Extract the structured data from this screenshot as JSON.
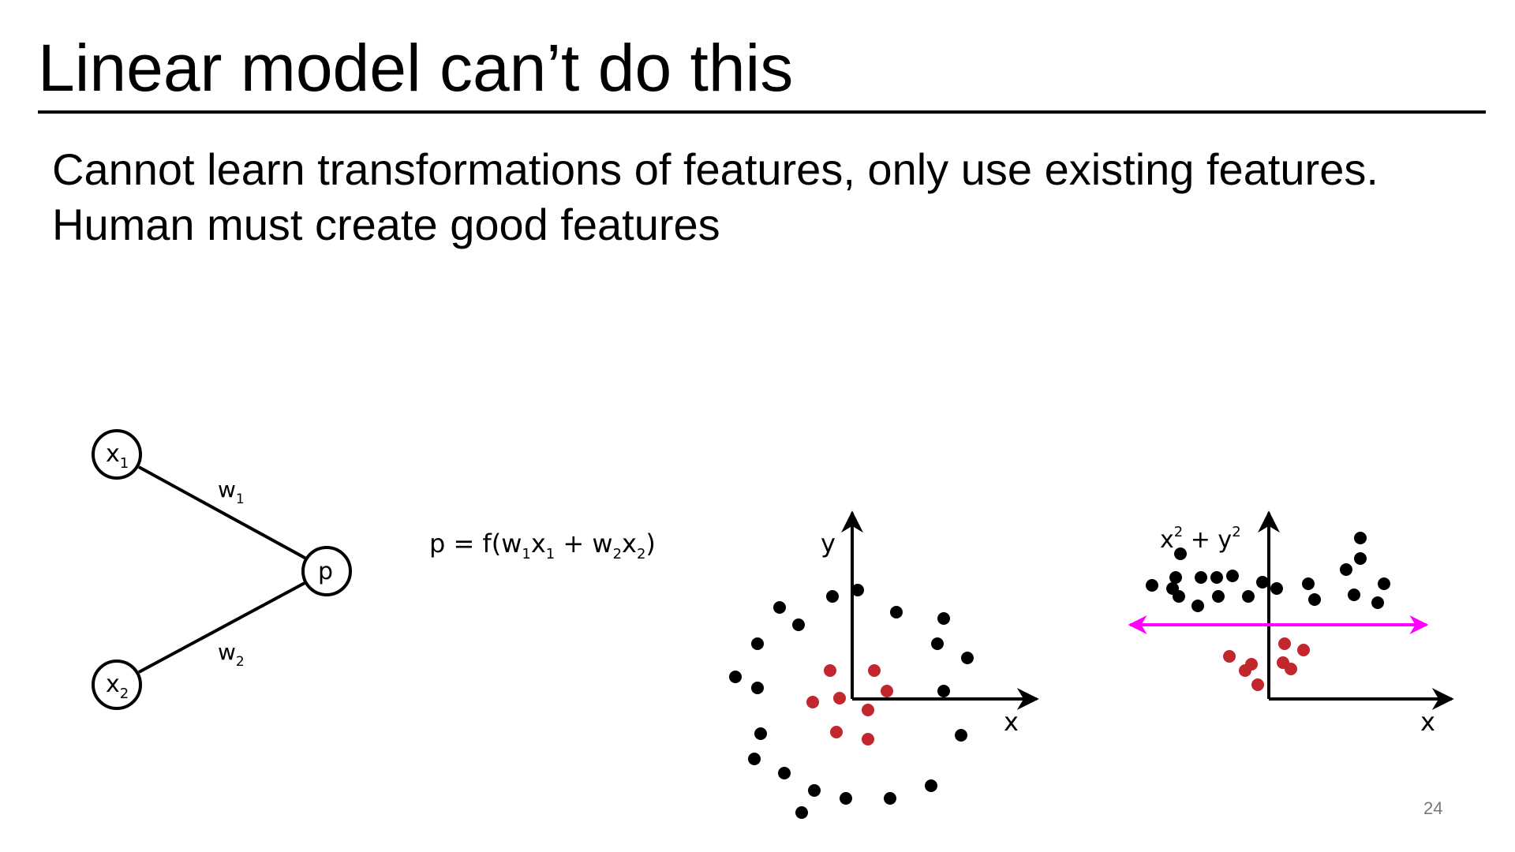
{
  "title": "Linear model can’t do this",
  "body": {
    "line1": "Cannot learn transformations of features, only use existing features.",
    "line2": "Human must create good features"
  },
  "page_number": "24",
  "network": {
    "input1": {
      "base": "x",
      "sub": "1"
    },
    "input2": {
      "base": "x",
      "sub": "2"
    },
    "output": "p",
    "weight1": {
      "base": "w",
      "sub": "1"
    },
    "weight2": {
      "base": "w",
      "sub": "2"
    }
  },
  "formula": {
    "prefix": "p = f(w",
    "sub1": "1",
    "x1": "x",
    "sub2": "1",
    "plus": " + w",
    "sub3": "2",
    "x2": "x",
    "sub4": "2",
    "suffix": ")"
  },
  "plot_left": {
    "xlabel": "x",
    "ylabel": "y"
  },
  "plot_right": {
    "xlabel": "x",
    "ylabel_a": "x",
    "sup_a": "2",
    "ylabel_plus": " + y",
    "sup_b": "2"
  },
  "colors": {
    "outer_points": "#000000",
    "inner_points": "#c1272d",
    "separator": "#ff00ff"
  }
}
